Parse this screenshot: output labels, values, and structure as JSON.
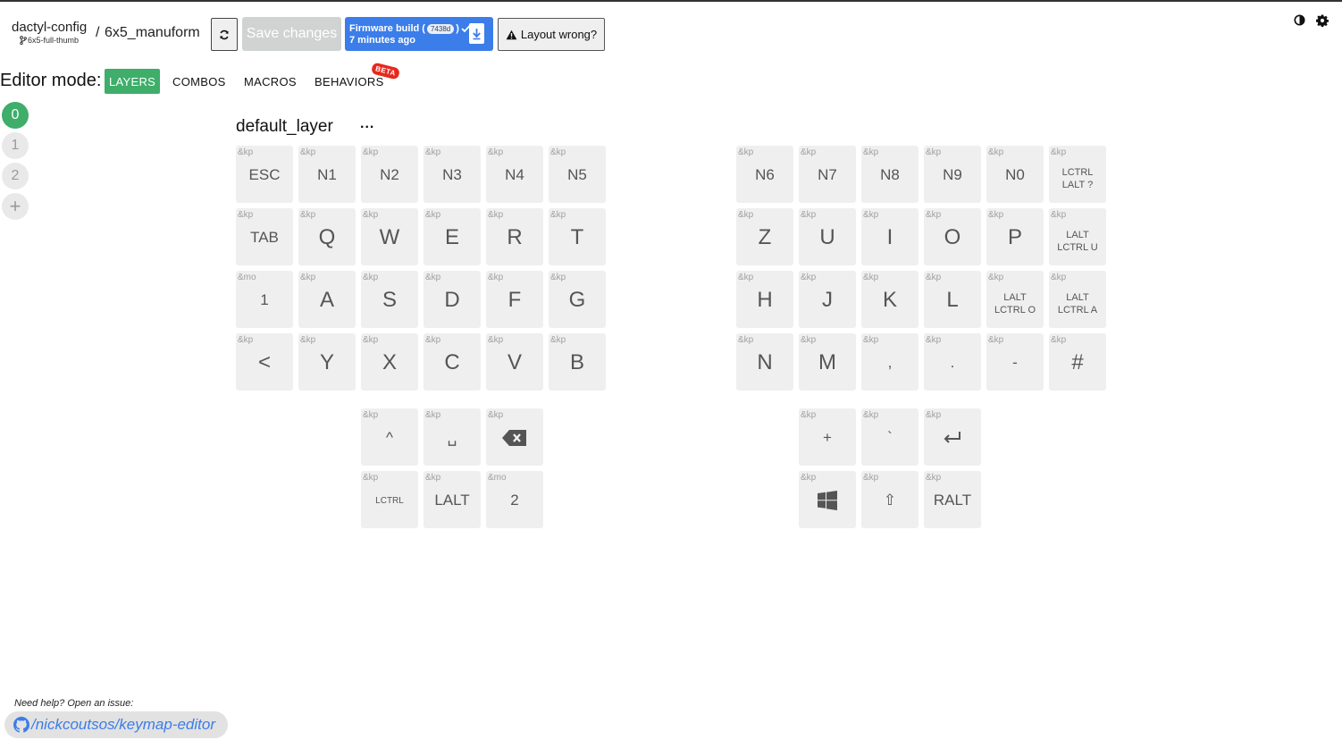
{
  "header": {
    "repo_name": "dactyl-config",
    "branch": "6x5-full-thumb",
    "separator": "/",
    "keyboard_name": "6x5_manuform",
    "save_label": "Save changes",
    "firmware": {
      "label": "Firmware build (",
      "sha": "7438d",
      "close": ")",
      "time": "7 minutes ago"
    },
    "layout_wrong_label": "Layout wrong?"
  },
  "editor": {
    "mode_label": "Editor mode:",
    "tabs": [
      "LAYERS",
      "COMBOS",
      "MACROS",
      "BEHAVIORS"
    ],
    "active_tab": "LAYERS",
    "beta_badge": "BETA"
  },
  "layers": {
    "items": [
      "0",
      "1",
      "2"
    ],
    "active": "0",
    "add_label": "+",
    "title": "default_layer",
    "menu_label": "..."
  },
  "keys": [
    {
      "b": "&kp",
      "p": "ESC"
    },
    {
      "b": "&kp",
      "p": "N1"
    },
    {
      "b": "&kp",
      "p": "N2"
    },
    {
      "b": "&kp",
      "p": "N3"
    },
    {
      "b": "&kp",
      "p": "N4"
    },
    {
      "b": "&kp",
      "p": "N5"
    },
    {
      "b": "&kp",
      "p": "N6"
    },
    {
      "b": "&kp",
      "p": "N7"
    },
    {
      "b": "&kp",
      "p": "N8"
    },
    {
      "b": "&kp",
      "p": "N9"
    },
    {
      "b": "&kp",
      "p": "N0"
    },
    {
      "b": "&kp",
      "p": "LCTRL LALT ?"
    },
    {
      "b": "&kp",
      "p": "TAB"
    },
    {
      "b": "&kp",
      "p": "Q"
    },
    {
      "b": "&kp",
      "p": "W"
    },
    {
      "b": "&kp",
      "p": "E"
    },
    {
      "b": "&kp",
      "p": "R"
    },
    {
      "b": "&kp",
      "p": "T"
    },
    {
      "b": "&kp",
      "p": "Z"
    },
    {
      "b": "&kp",
      "p": "U"
    },
    {
      "b": "&kp",
      "p": "I"
    },
    {
      "b": "&kp",
      "p": "O"
    },
    {
      "b": "&kp",
      "p": "P"
    },
    {
      "b": "&kp",
      "p": "LALT LCTRL U"
    },
    {
      "b": "&mo",
      "p": "1"
    },
    {
      "b": "&kp",
      "p": "A"
    },
    {
      "b": "&kp",
      "p": "S"
    },
    {
      "b": "&kp",
      "p": "D"
    },
    {
      "b": "&kp",
      "p": "F"
    },
    {
      "b": "&kp",
      "p": "G"
    },
    {
      "b": "&kp",
      "p": "H"
    },
    {
      "b": "&kp",
      "p": "J"
    },
    {
      "b": "&kp",
      "p": "K"
    },
    {
      "b": "&kp",
      "p": "L"
    },
    {
      "b": "&kp",
      "p": "LALT LCTRL O"
    },
    {
      "b": "&kp",
      "p": "LALT LCTRL A"
    },
    {
      "b": "&kp",
      "p": "<"
    },
    {
      "b": "&kp",
      "p": "Y"
    },
    {
      "b": "&kp",
      "p": "X"
    },
    {
      "b": "&kp",
      "p": "C"
    },
    {
      "b": "&kp",
      "p": "V"
    },
    {
      "b": "&kp",
      "p": "B"
    },
    {
      "b": "&kp",
      "p": "N"
    },
    {
      "b": "&kp",
      "p": "M"
    },
    {
      "b": "&kp",
      "p": ","
    },
    {
      "b": "&kp",
      "p": "."
    },
    {
      "b": "&kp",
      "p": "-"
    },
    {
      "b": "&kp",
      "p": "#"
    },
    {
      "b": "&kp",
      "p": "^"
    },
    {
      "b": "&kp",
      "p": "␣"
    },
    {
      "b": "&kp",
      "p": "",
      "icon": "backspace-icon"
    },
    {
      "b": "&kp",
      "p": "+"
    },
    {
      "b": "&kp",
      "p": "`"
    },
    {
      "b": "&kp",
      "p": "",
      "icon": "enter-icon"
    },
    {
      "b": "&kp",
      "p": "LCTRL"
    },
    {
      "b": "&kp",
      "p": "LALT"
    },
    {
      "b": "&mo",
      "p": "2"
    },
    {
      "b": "&kp",
      "p": "",
      "icon": "windows-icon"
    },
    {
      "b": "&kp",
      "p": "⇧"
    },
    {
      "b": "&kp",
      "p": "RALT"
    }
  ],
  "footer": {
    "help_text": "Need help? Open an issue:",
    "repo_link": "/nickcoutsos/keymap-editor"
  },
  "colors": {
    "accent_green": "#3eae6a",
    "firmware_blue": "#3b7de9",
    "beta_red": "#e8281d",
    "key_bg": "#efefef"
  }
}
